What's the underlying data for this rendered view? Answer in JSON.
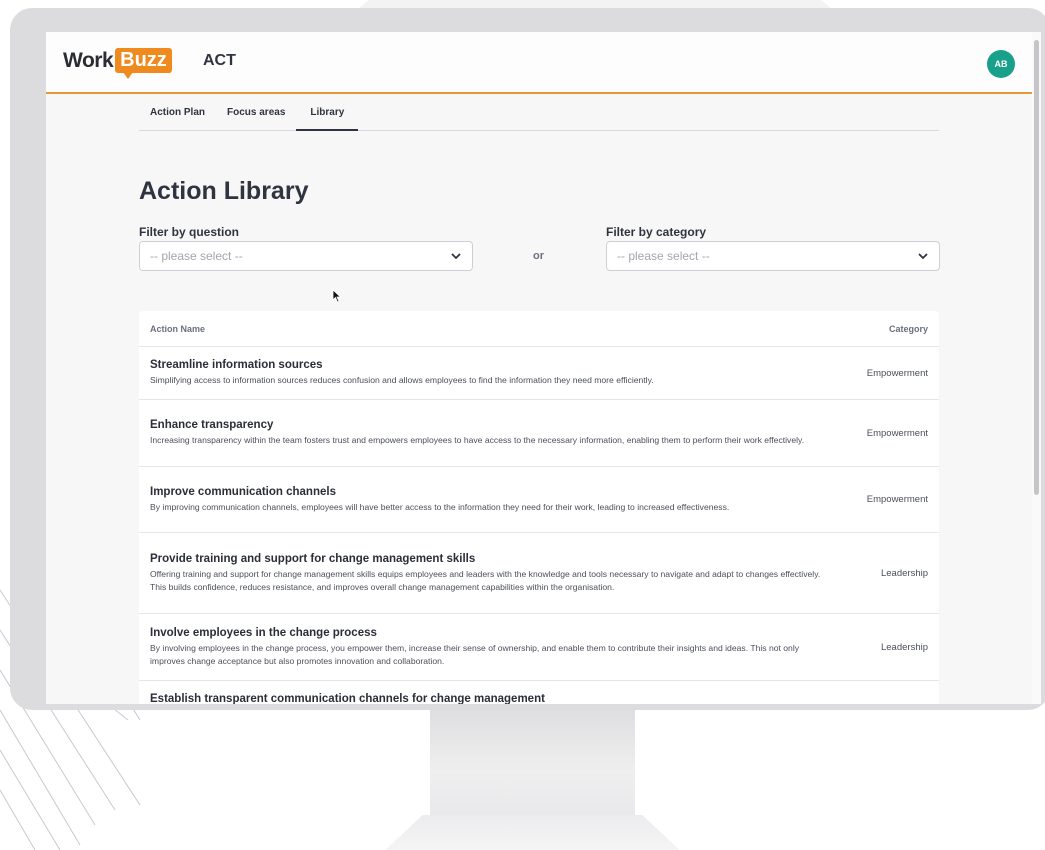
{
  "brand": {
    "logo_work": "Work",
    "logo_buzz": "Buzz",
    "app_name": "ACT",
    "colors": {
      "accent": "#ef8a1f",
      "avatar": "#18a08a",
      "text": "#2f3440"
    }
  },
  "user": {
    "initials": "AB"
  },
  "tabs": [
    {
      "label": "Action Plan"
    },
    {
      "label": "Focus areas"
    },
    {
      "label": "Library",
      "active": true
    }
  ],
  "page": {
    "title": "Action Library"
  },
  "filters": {
    "question": {
      "label": "Filter by question",
      "value": "-- please select --"
    },
    "separator": "or",
    "category": {
      "label": "Filter by category",
      "value": "-- please select --"
    }
  },
  "table": {
    "headers": {
      "name": "Action Name",
      "category": "Category"
    },
    "rows": [
      {
        "name": "Streamline information sources",
        "description": "Simplifying access to information sources reduces confusion and allows employees to find the information they need more efficiently.",
        "category": "Empowerment"
      },
      {
        "name": "Enhance transparency",
        "description": "Increasing transparency within the team fosters trust and empowers employees to have access to the necessary information, enabling them to perform their work effectively.",
        "category": "Empowerment"
      },
      {
        "name": "Improve communication channels",
        "description": "By improving communication channels, employees will have better access to the information they need for their work, leading to increased effectiveness.",
        "category": "Empowerment"
      },
      {
        "name": "Provide training and support for change management skills",
        "description": "Offering training and support for change management skills equips employees and leaders with the knowledge and tools necessary to navigate and adapt to changes effectively. This builds confidence, reduces resistance, and improves overall change management capabilities within the organisation.",
        "category": "Leadership"
      },
      {
        "name": "Involve employees in the change process",
        "description": "By involving employees in the change process, you empower them, increase their sense of ownership, and enable them to contribute their insights and ideas. This not only improves change acceptance but also promotes innovation and collaboration.",
        "category": "Leadership"
      },
      {
        "name": "Establish transparent communication channels for change management",
        "description": "",
        "category": ""
      }
    ]
  }
}
